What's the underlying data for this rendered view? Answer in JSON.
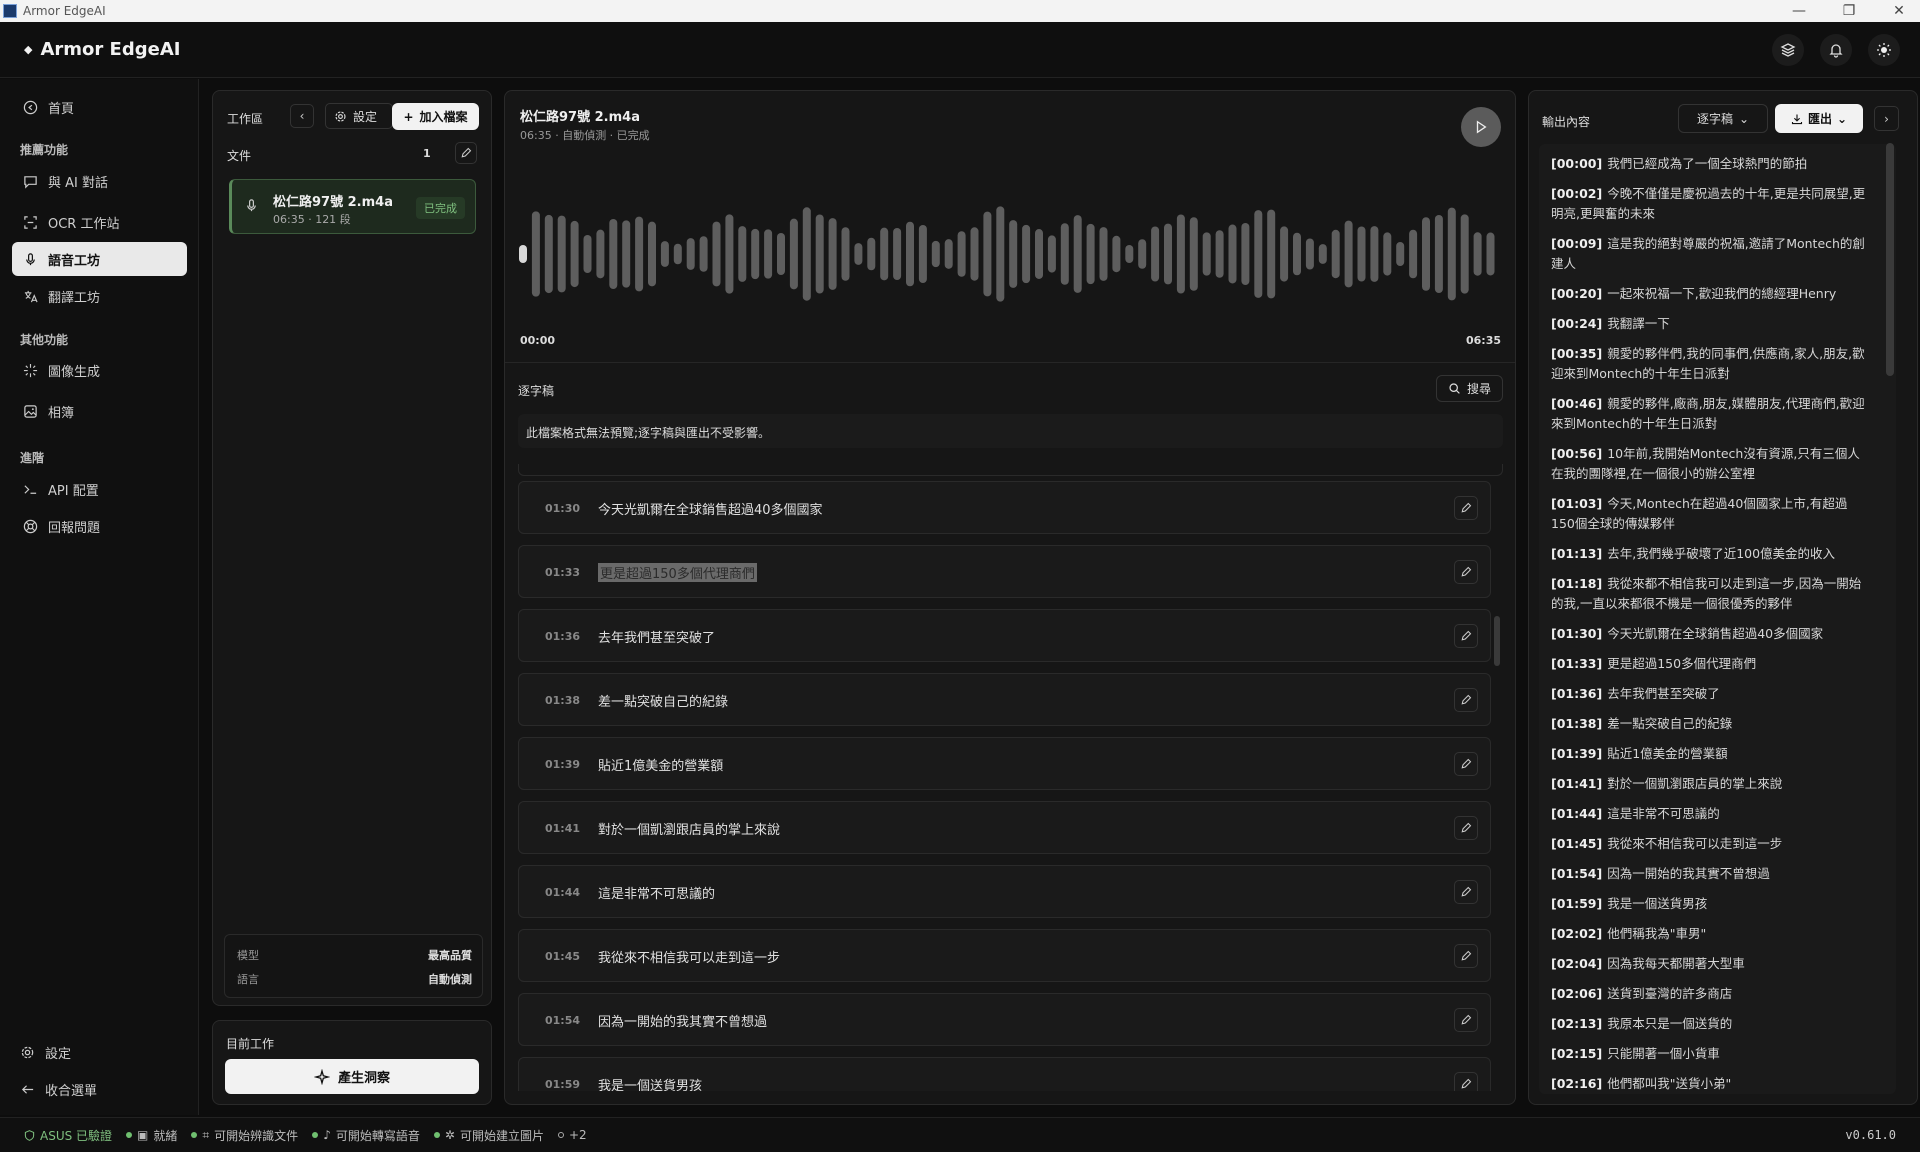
{
  "window": {
    "title": "Armor EdgeAI",
    "minimize": "—",
    "maximize": "❐",
    "close": "✕"
  },
  "header": {
    "brand": "Armor EdgeAI"
  },
  "sidebar": {
    "home": "首頁",
    "section_recommended": "推薦功能",
    "chat": "與 AI 對話",
    "ocr": "OCR 工作站",
    "voice": "語音工坊",
    "translate": "翻譯工坊",
    "section_other": "其他功能",
    "image_gen": "圖像生成",
    "album": "相簿",
    "section_advanced": "進階",
    "api": "API 配置",
    "report": "回報問題",
    "settings": "設定",
    "collapse": "收合選單"
  },
  "workspace": {
    "title": "工作區",
    "settings": "設定",
    "add_file": "加入檔案",
    "files_label": "文件",
    "files_count": "1",
    "file": {
      "name": "松仁路97號 2.m4a",
      "meta": "06:35 · 121 段",
      "status": "已完成"
    },
    "model_label": "模型",
    "model_value": "最高品質",
    "language_label": "語言",
    "language_value": "自動偵測",
    "current_title": "目前工作",
    "insight_button": "產生洞察"
  },
  "player": {
    "title": "松仁路97號 2.m4a",
    "meta": "06:35 · 自動偵測 · 已完成",
    "start": "00:00",
    "end": "06:35",
    "progress": 0
  },
  "transcript": {
    "label": "逐字稿",
    "search": "搜尋",
    "notice": "此檔案格式無法預覽;逐字稿與匯出不受影響。",
    "segments": [
      {
        "time": "01:30",
        "text": "今天光凱爾在全球銷售超過40多個國家"
      },
      {
        "time": "01:33",
        "text": "更是超過150多個代理商們"
      },
      {
        "time": "01:36",
        "text": "去年我們甚至突破了"
      },
      {
        "time": "01:38",
        "text": "差一點突破自己的紀錄"
      },
      {
        "time": "01:39",
        "text": "貼近1億美金的營業額"
      },
      {
        "time": "01:41",
        "text": "對於一個凱瀏跟店員的掌上來說"
      },
      {
        "time": "01:44",
        "text": "這是非常不可思議的"
      },
      {
        "time": "01:45",
        "text": "我從來不相信我可以走到這一步"
      },
      {
        "time": "01:54",
        "text": "因為一開始的我其實不曾想過"
      },
      {
        "time": "01:59",
        "text": "我是一個送貨男孩"
      }
    ]
  },
  "output": {
    "title": "輸出內容",
    "mode": "逐字稿",
    "export": "匯出",
    "lines": [
      {
        "ts": "[00:00]",
        "text": "我們已經成為了一個全球熱門的節拍"
      },
      {
        "ts": "[00:02]",
        "text": "今晚不僅僅是慶祝過去的十年,更是共同展望,更明亮,更興奮的未來"
      },
      {
        "ts": "[00:09]",
        "text": "這是我的絕對尊嚴的祝福,邀請了Montech的創建人"
      },
      {
        "ts": "[00:20]",
        "text": "一起來祝福一下,歡迎我們的總經理Henry"
      },
      {
        "ts": "[00:24]",
        "text": "我翻譯一下"
      },
      {
        "ts": "[00:35]",
        "text": "親愛的夥伴們,我的同事們,供應商,家人,朋友,歡迎來到Montech的十年生日派對"
      },
      {
        "ts": "[00:46]",
        "text": "親愛的夥伴,廠商,朋友,媒體朋友,代理商們,歡迎來到Montech的十年生日派對"
      },
      {
        "ts": "[00:56]",
        "text": "10年前,我開始Montech沒有資源,只有三個人在我的團隊裡,在一個很小的辦公室裡"
      },
      {
        "ts": "[01:03]",
        "text": "今天,Montech在超過40個國家上市,有超過150個全球的傳媒夥伴"
      },
      {
        "ts": "[01:13]",
        "text": "去年,我們幾乎破壞了近100億美金的收入"
      },
      {
        "ts": "[01:18]",
        "text": "我從來都不相信我可以走到這一步,因為一開始的我,一直以來都很不機是一個很優秀的夥伴"
      },
      {
        "ts": "[01:30]",
        "text": "今天光凱爾在全球銷售超過40多個國家"
      },
      {
        "ts": "[01:33]",
        "text": "更是超過150多個代理商們"
      },
      {
        "ts": "[01:36]",
        "text": "去年我們甚至突破了"
      },
      {
        "ts": "[01:38]",
        "text": "差一點突破自己的紀錄"
      },
      {
        "ts": "[01:39]",
        "text": "貼近1億美金的營業額"
      },
      {
        "ts": "[01:41]",
        "text": "對於一個凱瀏跟店員的掌上來說"
      },
      {
        "ts": "[01:44]",
        "text": "這是非常不可思議的"
      },
      {
        "ts": "[01:45]",
        "text": "我從來不相信我可以走到這一步"
      },
      {
        "ts": "[01:54]",
        "text": "因為一開始的我其實不曾想過"
      },
      {
        "ts": "[01:59]",
        "text": "我是一個送貨男孩"
      },
      {
        "ts": "[02:02]",
        "text": "他們稱我為\"車男\""
      },
      {
        "ts": "[02:04]",
        "text": "因為我每天都開著大型車"
      },
      {
        "ts": "[02:06]",
        "text": "送貨到臺灣的許多商店"
      },
      {
        "ts": "[02:13]",
        "text": "我原本只是一個送貨的"
      },
      {
        "ts": "[02:15]",
        "text": "只能開著一個小貨車"
      },
      {
        "ts": "[02:16]",
        "text": "他們都叫我\"送貨小弟\""
      }
    ]
  },
  "status": {
    "asus": "ASUS 已驗證",
    "ready": "就緒",
    "doc": "可開始辨識文件",
    "voice": "可開始轉寫語音",
    "image": "可開始建立圖片",
    "more": "+2",
    "version": "v0.61.0"
  }
}
